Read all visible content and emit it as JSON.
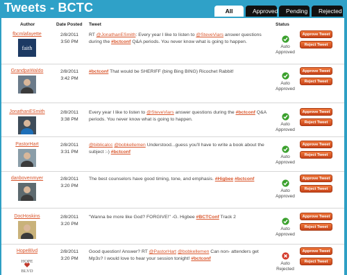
{
  "header": {
    "title": "Tweets - BCTC"
  },
  "tabs": [
    {
      "label": "All",
      "active": true
    },
    {
      "label": "Approved",
      "active": false
    },
    {
      "label": "Pending",
      "active": false
    },
    {
      "label": "Rejected",
      "active": false
    }
  ],
  "columns": {
    "author": "Author",
    "date": "Date Posted",
    "tweet": "Tweet",
    "status": "Status"
  },
  "buttons": {
    "approve": "Approve Tweet",
    "reject": "Reject Tweet"
  },
  "colors": {
    "accent": "#d9552b",
    "header": "#2fa1c8",
    "approved": "#3aa02c",
    "rejected": "#d43b2b"
  },
  "rows": [
    {
      "author": "fbcmlafayette",
      "avatar_label": "faith",
      "date": "2/8/2011",
      "time": "3:50 PM",
      "tweet": [
        {
          "t": "RT "
        },
        {
          "m": "@JonathanESmith"
        },
        {
          "t": ": Every year I like to listen to "
        },
        {
          "m": "@SteveViars"
        },
        {
          "t": " answer questions during the "
        },
        {
          "h": "#bctconf"
        },
        {
          "t": " Q&A periods. You never know what is going to happen."
        }
      ],
      "status": "Auto Approved",
      "status_kind": "approved"
    },
    {
      "author": "GrandpaWaldo",
      "date": "2/8/2011",
      "time": "3:42 PM",
      "tweet": [
        {
          "h": "#bctconf"
        },
        {
          "t": " That would be SHERIFF (bing Bing BING) Ricochet Rabbit!"
        }
      ],
      "status": "Auto Approved",
      "status_kind": "approved"
    },
    {
      "author": "JonathanESmith",
      "date": "2/8/2011",
      "time": "3:38 PM",
      "tweet": [
        {
          "t": "Every year I like to listen to "
        },
        {
          "m": "@SteveViars"
        },
        {
          "t": " answer questions during the "
        },
        {
          "h": "#bctconf"
        },
        {
          "t": " Q&A periods. You never know what is going to happen."
        }
      ],
      "status": "Auto Approved",
      "status_kind": "approved"
    },
    {
      "author": "PastorHart",
      "date": "2/8/2011",
      "time": "3:31 PM",
      "tweet": [
        {
          "m": "@biblicalcc"
        },
        {
          "t": " "
        },
        {
          "m": "@bobkellemen"
        },
        {
          "t": " Understood...guess you'll have to write a book about the subject :-) "
        },
        {
          "h": "#bctconf"
        }
      ],
      "status": "Auto Approved",
      "status_kind": "approved"
    },
    {
      "author": "danbovenmyer",
      "date": "2/8/2011",
      "time": "3:20 PM",
      "tweet": [
        {
          "t": "The best counselors have good timing, tone, and emphasis. "
        },
        {
          "h": "#Higbee"
        },
        {
          "t": " "
        },
        {
          "h": "#bctconf"
        }
      ],
      "status": "Auto Approved",
      "status_kind": "approved"
    },
    {
      "author": "DocHoskins",
      "date": "2/8/2011",
      "time": "3:20 PM",
      "tweet": [
        {
          "t": "\"Wanna be more like God? FORGIVE!\" -G. Higbee "
        },
        {
          "h": "#BCTConf"
        },
        {
          "t": " Track 2"
        }
      ],
      "status": "Auto Approved",
      "status_kind": "approved"
    },
    {
      "author": "HopeBlvd",
      "avatar_label": "HOPE BLVD",
      "date": "2/8/2011",
      "time": "3:20 PM",
      "tweet": [
        {
          "t": "Good question! Answer? RT "
        },
        {
          "m": "@PastorHart"
        },
        {
          "t": " "
        },
        {
          "m": "@bobkellemen"
        },
        {
          "t": " Can non- attenders get Mp3s? I would love to hear your session tonight! "
        },
        {
          "h": "#bctconf"
        }
      ],
      "status": "Auto Rejected",
      "status_kind": "rejected"
    }
  ]
}
